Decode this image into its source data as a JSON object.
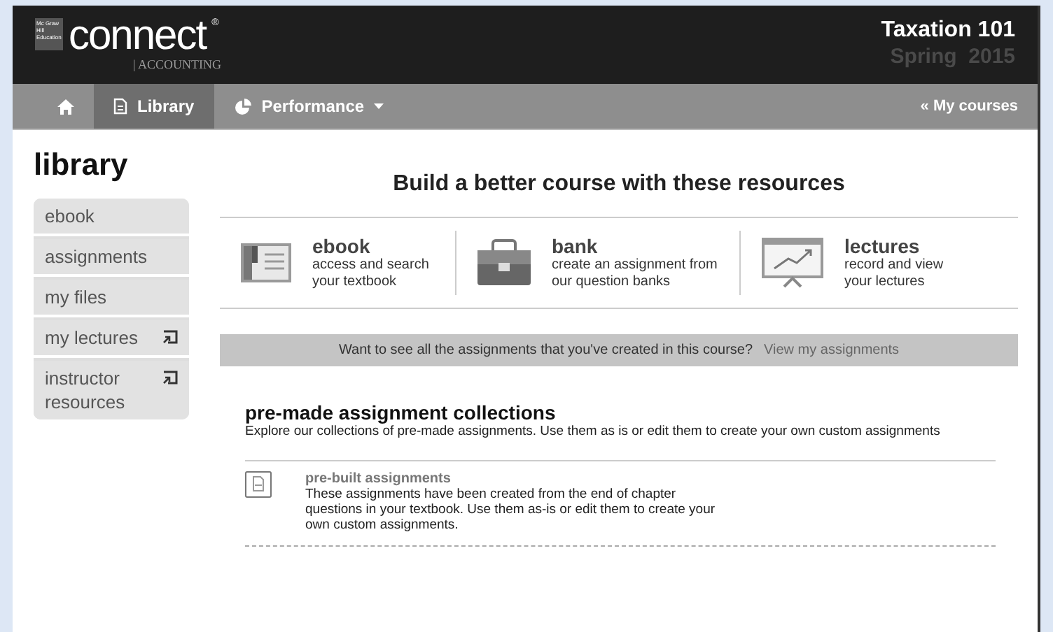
{
  "header": {
    "logo_badge": "Mc Graw Hill Education",
    "logo_word": "connect",
    "logo_mark": "®",
    "product": "| ACCOUNTING",
    "course_title": "Taxation 101",
    "term": "Spring  2015"
  },
  "nav": {
    "items": [
      {
        "kind": "home",
        "selected": false
      },
      {
        "kind": "library",
        "label": "Library",
        "selected": true
      },
      {
        "kind": "performance",
        "label": "Performance",
        "selected": false
      }
    ],
    "back_link": "« My courses"
  },
  "page_title": "library",
  "sidebar": {
    "items": [
      {
        "label": "ebook",
        "external": false
      },
      {
        "label": "assignments",
        "external": false
      },
      {
        "label": "my files",
        "external": false
      },
      {
        "label": "my lectures",
        "external": true
      },
      {
        "label": "instructor resources",
        "external": true
      }
    ]
  },
  "resources": {
    "heading": "Build a better course with these resources",
    "items": [
      {
        "kind": "ebook",
        "title": "ebook",
        "description": "access and search your textbook"
      },
      {
        "kind": "bank",
        "title": "bank",
        "description": "create an assignment from our question banks"
      },
      {
        "kind": "lectures",
        "title": "lectures",
        "description": "record and view your lectures"
      }
    ]
  },
  "banner": {
    "text": "Want to see all the assignments that you've created in this course?",
    "link": "View my assignments"
  },
  "collections": {
    "title": "pre-made assignment collections",
    "description": "Explore our collections of pre-made assignments. Use them as is or edit them to create your own custom assignments",
    "items": [
      {
        "title": "pre-built assignments",
        "description": "These assignments have been created from the end of chapter questions in your textbook. Use them as-is or edit them to create your own custom assignments."
      }
    ]
  }
}
